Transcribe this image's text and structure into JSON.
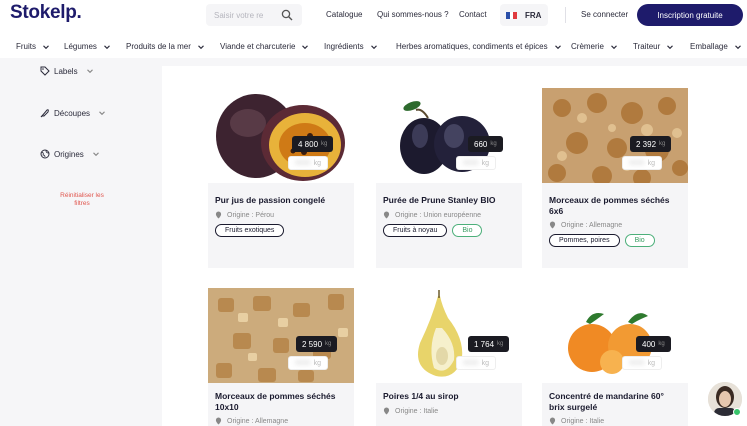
{
  "header": {
    "logo": "Stokelp.",
    "search_placeholder": "Saisir votre re",
    "nav": [
      "Catalogue",
      "Qui sommes-nous ?",
      "Contact"
    ],
    "lang": "FRA",
    "login": "Se connecter",
    "cta": "Inscription gratuite"
  },
  "categories": [
    "Fruits",
    "Légumes",
    "Produits de la mer",
    "Viande et charcuterie",
    "Ingrédients",
    "Herbes aromatiques, condiments et épices",
    "Crèmerie",
    "Traiteur",
    "Emballage"
  ],
  "sidebar": {
    "filters": [
      "Labels",
      "Découpes",
      "Origines"
    ],
    "reset": "Réinitialiser les filtres"
  },
  "products": [
    {
      "title": "Pur jus de passion congelé",
      "price": "4 800",
      "unit": "kg",
      "unit2": "kg",
      "origin": "Origine : Pérou",
      "tags": [
        "Fruits exotiques"
      ],
      "bio": false
    },
    {
      "title": "Purée de Prune Stanley BIO",
      "price": "660",
      "unit": "kg",
      "unit2": "kg",
      "origin": "Origine : Union européenne",
      "tags": [
        "Fruits à noyau"
      ],
      "bio": true
    },
    {
      "title": "Morceaux de pommes séchés 6x6",
      "price": "2 392",
      "unit": "kg",
      "unit2": "kg",
      "origin": "Origine : Allemagne",
      "tags": [
        "Pommes, poires"
      ],
      "bio": true
    },
    {
      "title": "Morceaux de pommes séchés 10x10",
      "price": "2 590",
      "unit": "kg",
      "unit2": "kg",
      "origin": "Origine : Allemagne",
      "tags": [],
      "bio": false
    },
    {
      "title": "Poires 1/4 au sirop",
      "price": "1 764",
      "unit": "kg",
      "unit2": "kg",
      "origin": "Origine : Italie",
      "tags": [],
      "bio": false
    },
    {
      "title": "Concentré de mandarine 60° brix surgelé",
      "price": "400",
      "unit": "kg",
      "unit2": "kg",
      "origin": "Origine : Italie",
      "tags": [],
      "bio": false
    }
  ],
  "bio_label": "Bio",
  "colors": {
    "brand": "#1e1b6b",
    "reset": "#e0554d",
    "bio": "#3a9d63",
    "price_bg": "#1b1b22"
  }
}
